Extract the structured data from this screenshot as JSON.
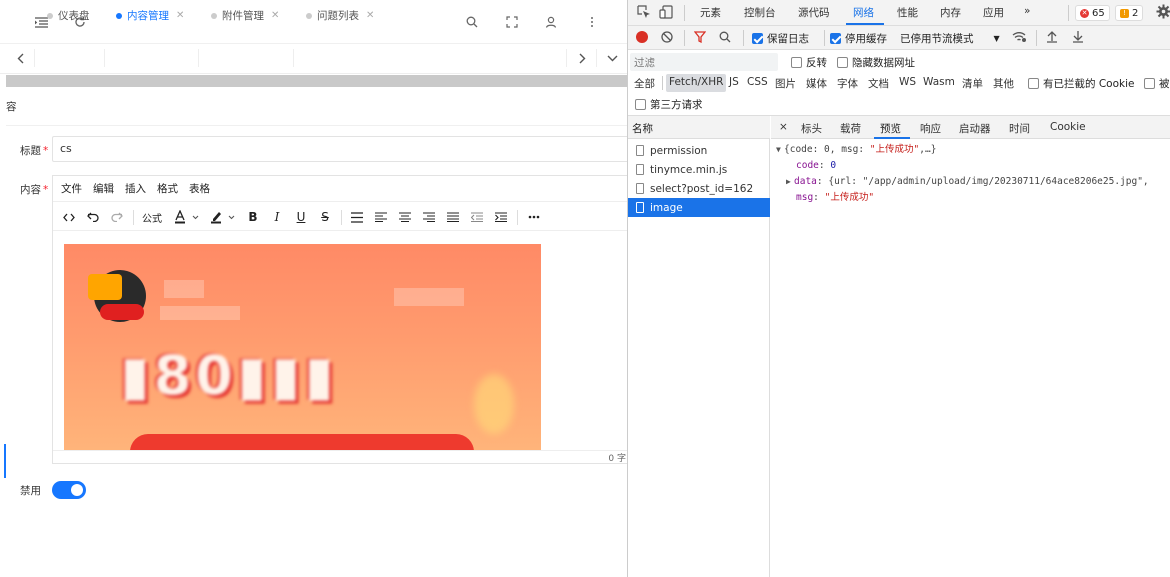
{
  "app": {
    "tabs": [
      {
        "label": "仪表盘"
      },
      {
        "label": "内容管理"
      },
      {
        "label": "附件管理"
      },
      {
        "label": "问题列表"
      }
    ],
    "page_title": "容",
    "form": {
      "title_label": "标题",
      "title_value": "cs",
      "content_label": "内容",
      "disabled_label": "禁用",
      "required_mark": "*"
    },
    "editor": {
      "menu": [
        "文件",
        "编辑",
        "插入",
        "格式",
        "表格"
      ],
      "formula_label": "公式",
      "word_count": "0 字"
    }
  },
  "devtools": {
    "tabs": [
      "元素",
      "控制台",
      "源代码",
      "网络",
      "性能",
      "内存",
      "应用"
    ],
    "more_tabs": "»",
    "error_count": "65",
    "warning_count": "2",
    "toolbar": {
      "preserve_log": "保留日志",
      "disable_cache": "停用缓存",
      "throttle": "已停用节流模式"
    },
    "filter": {
      "placeholder": "过滤",
      "invert": "反转",
      "hide_data_urls": "隐藏数据网址",
      "types": [
        "全部",
        "Fetch/XHR",
        "JS",
        "CSS",
        "图片",
        "媒体",
        "字体",
        "文档",
        "WS",
        "Wasm",
        "清单",
        "其他"
      ],
      "blocked_cookies": "有已拦截的 Cookie",
      "blocked_requests": "被",
      "third_party": "第三方请求"
    },
    "request_list": {
      "header": "名称",
      "items": [
        "permission",
        "tinymce.min.js",
        "select?post_id=162",
        "image"
      ]
    },
    "detail_tabs": [
      "标头",
      "载荷",
      "预览",
      "响应",
      "启动器",
      "时间",
      "Cookie"
    ],
    "close_symbol": "×",
    "preview": {
      "summary_open": "{code: 0, msg: ",
      "summary_msg": "\"上传成功\"",
      "summary_close": ",…}",
      "code_key": "code",
      "code_value": "0",
      "data_key": "data",
      "data_value": "{url: \"/app/admin/upload/img/20230711/64ace8206e25.jpg\",",
      "msg_key": "msg",
      "msg_value": "\"上传成功\""
    }
  },
  "colors": {
    "accent": "#1677ff",
    "devtools_accent": "#1a73e8",
    "required": "#f5222d",
    "error_badge": "#e53935",
    "warning_badge": "#f29900"
  }
}
